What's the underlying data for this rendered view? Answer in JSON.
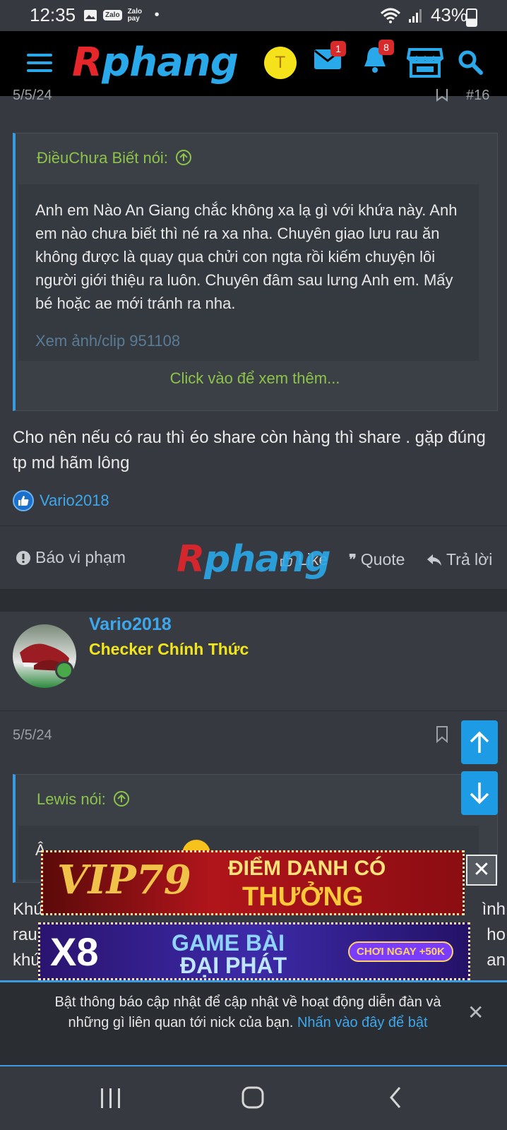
{
  "status_bar": {
    "time": "12:35",
    "left_icons": [
      "image-icon",
      "zalo-icon",
      "zalopay-icon"
    ],
    "zalo_label": "Zalo",
    "zalopay_label": "Zalo pay",
    "dot": "•",
    "battery": "43%"
  },
  "header": {
    "logo_r": "R",
    "logo_rest": "phang",
    "avatar_letter": "T",
    "messages_badge": "1",
    "alerts_badge": "8"
  },
  "post1": {
    "date_partial": "5/5/24",
    "number_partial": "#16",
    "quote": {
      "author_line": "ĐiềuChưa Biết nói:",
      "body": "Anh em Nào An Giang chắc không xa lạ gì với khứa này. Anh em nào chưa biết thì né ra xa nha. Chuyên giao lưu rau ăn không được là quay qua chửi con ngta rồi kiếm chuyện lôi người giới thiệu ra luôn. Chuyên đâm sau lưng Anh em. Mấy bé hoặc ae mới tránh ra nha.",
      "faded_link": "Xem ảnh/clip 951108",
      "expand": "Click vào để xem thêm..."
    },
    "text": "Cho nên nếu có rau thì éo share còn hàng thì share . gặp đúng tp md hãm lông",
    "reaction_user": "Vario2018",
    "actions": {
      "report": "Báo vi phạm",
      "like": "Like",
      "quote": "Quote",
      "reply": "Trả lời"
    },
    "watermark_r": "R",
    "watermark_rest": "phang"
  },
  "post2": {
    "username": "Vario2018",
    "user_title": "Checker Chính Thức",
    "date": "5/5/24",
    "quote": {
      "author_line": "Lewis nói:",
      "body_partial": "Â"
    },
    "text_partial_left": [
      "Khứ",
      "rau",
      "khứ"
    ],
    "text_partial_right": [
      "ình",
      "ho",
      "an"
    ]
  },
  "ads": {
    "ad1_brand": "VIP79",
    "ad1_line1": "ĐIỂM DANH CÓ",
    "ad1_line2": "THƯỞNG",
    "ad2_brand": "X8",
    "ad2_line1": "GAME BÀI",
    "ad2_line2": "ĐẠI PHÁT",
    "ad2_cta": "CHƠI NGAY +50K",
    "close": "✕"
  },
  "notification": {
    "text": "Bật thông báo cập nhật để cập nhật về hoạt động diễn đàn và những gì liên quan tới nick của bạn.",
    "link": "Nhấn vào đây để bật",
    "close": "✕"
  },
  "colors": {
    "accent_blue": "#3ea7ec",
    "quote_green": "#8dc34a",
    "user_title_yellow": "#f2e61a",
    "badge_red": "#d72b2b",
    "page_bg": "#363a40"
  }
}
